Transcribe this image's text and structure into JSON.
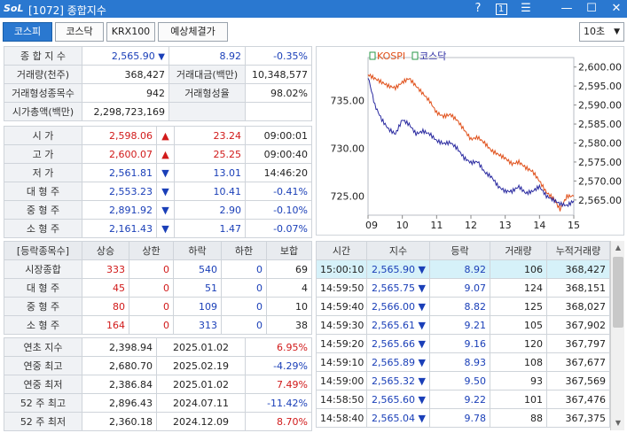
{
  "window": {
    "logo": "SoL",
    "title": "[1072] 종합지수",
    "help": "?",
    "one": "1",
    "menu": "☰",
    "minimize": "—",
    "maximize": "☐",
    "close": "✕"
  },
  "toolbar": {
    "tabs": [
      "코스피",
      "코스닥",
      "KRX100",
      "예상체결가"
    ],
    "active_tab": "코스피",
    "interval": "10초"
  },
  "summary": {
    "index_label": "종 합 지 수",
    "index_value": "2,565.90",
    "index_change": "8.92",
    "index_rate": "-0.35%",
    "volume_label": "거래량(천주)",
    "volume_value": "368,427",
    "amount_label": "거래대금(백만)",
    "amount_value": "10,348,577",
    "formed_count_label": "거래형성종목수",
    "formed_count_value": "942",
    "formed_rate_label": "거래형성율",
    "formed_rate_value": "98.02%",
    "mktcap_label": "시가총액(백만)",
    "mktcap_value": "2,298,723,169"
  },
  "prices": [
    {
      "label": "시      가",
      "value": "2,598.06",
      "dir": "up",
      "change": "23.24",
      "extra": "09:00:01"
    },
    {
      "label": "고      가",
      "value": "2,600.07",
      "dir": "up",
      "change": "25.25",
      "extra": "09:00:40"
    },
    {
      "label": "저      가",
      "value": "2,561.81",
      "dir": "dn",
      "change": "13.01",
      "extra": "14:46:20"
    },
    {
      "label": "대 형 주",
      "value": "2,553.23",
      "dir": "dn",
      "change": "10.41",
      "extra": "-0.41%"
    },
    {
      "label": "중 형 주",
      "value": "2,891.92",
      "dir": "dn",
      "change": "2.90",
      "extra": "-0.10%"
    },
    {
      "label": "소 형 주",
      "value": "2,161.43",
      "dir": "dn",
      "change": "1.47",
      "extra": "-0.07%"
    }
  ],
  "breadth": {
    "headers": [
      "[등락종목수]",
      "상승",
      "상한",
      "하락",
      "하한",
      "보합"
    ],
    "rows": [
      {
        "label": "시장종합",
        "rise": "333",
        "upper": "0",
        "fall": "540",
        "lower": "0",
        "flat": "69"
      },
      {
        "label": "대 형 주",
        "rise": "45",
        "upper": "0",
        "fall": "51",
        "lower": "0",
        "flat": "4"
      },
      {
        "label": "중 형 주",
        "rise": "80",
        "upper": "0",
        "fall": "109",
        "lower": "0",
        "flat": "10"
      },
      {
        "label": "소 형 주",
        "rise": "164",
        "upper": "0",
        "fall": "313",
        "lower": "0",
        "flat": "38"
      }
    ]
  },
  "yearly": [
    {
      "label": "연초  지수",
      "value": "2,398.94",
      "date": "2025.01.02",
      "rate": "6.95%",
      "dir": "up"
    },
    {
      "label": "연중  최고",
      "value": "2,680.70",
      "date": "2025.02.19",
      "rate": "-4.29%",
      "dir": "dn"
    },
    {
      "label": "연중  최저",
      "value": "2,386.84",
      "date": "2025.01.02",
      "rate": "7.49%",
      "dir": "up"
    },
    {
      "label": "52 주 최고",
      "value": "2,896.43",
      "date": "2024.07.11",
      "rate": "-11.42%",
      "dir": "dn"
    },
    {
      "label": "52 주 최저",
      "value": "2,360.18",
      "date": "2024.12.09",
      "rate": "8.70%",
      "dir": "up"
    }
  ],
  "ticks": {
    "headers": [
      "시간",
      "지수",
      "등락",
      "거래량",
      "누적거래량"
    ],
    "rows": [
      {
        "time": "15:00:10",
        "index": "2,565.90",
        "change": "8.92",
        "vol": "106",
        "cum": "368,427"
      },
      {
        "time": "14:59:50",
        "index": "2,565.75",
        "change": "9.07",
        "vol": "124",
        "cum": "368,151"
      },
      {
        "time": "14:59:40",
        "index": "2,566.00",
        "change": "8.82",
        "vol": "125",
        "cum": "368,027"
      },
      {
        "time": "14:59:30",
        "index": "2,565.61",
        "change": "9.21",
        "vol": "105",
        "cum": "367,902"
      },
      {
        "time": "14:59:20",
        "index": "2,565.66",
        "change": "9.16",
        "vol": "120",
        "cum": "367,797"
      },
      {
        "time": "14:59:10",
        "index": "2,565.89",
        "change": "8.93",
        "vol": "108",
        "cum": "367,677"
      },
      {
        "time": "14:59:00",
        "index": "2,565.32",
        "change": "9.50",
        "vol": "93",
        "cum": "367,569"
      },
      {
        "time": "14:58:50",
        "index": "2,565.60",
        "change": "9.22",
        "vol": "101",
        "cum": "367,476"
      },
      {
        "time": "14:58:40",
        "index": "2,565.04",
        "change": "9.78",
        "vol": "88",
        "cum": "367,375"
      }
    ],
    "selected_row": 0
  },
  "chart_data": {
    "type": "line",
    "x_ticks": [
      "09",
      "10",
      "11",
      "12",
      "13",
      "14",
      "15"
    ],
    "x_range": [
      9,
      15
    ],
    "left_axis": {
      "ticks": [
        "735.00",
        "730.00",
        "725.00"
      ],
      "range": [
        723.0,
        739.5
      ]
    },
    "right_axis": {
      "ticks": [
        "2,600.00",
        "2,595.00",
        "2,590.00",
        "2,585.00",
        "2,580.00",
        "2,575.00",
        "2,570.00",
        "2,565.00"
      ],
      "range": [
        2561.0,
        2602.5
      ]
    },
    "legend": "top-left",
    "series": [
      {
        "name": "KOSPI",
        "axis": "right",
        "color": "#e0501a",
        "x": [
          9.0,
          9.2,
          9.4,
          9.6,
          9.8,
          10.0,
          10.2,
          10.4,
          10.6,
          10.8,
          11.0,
          11.2,
          11.4,
          11.6,
          11.8,
          12.0,
          12.2,
          12.4,
          12.6,
          12.8,
          13.0,
          13.2,
          13.4,
          13.6,
          13.8,
          14.0,
          14.2,
          14.4,
          14.6,
          14.8,
          15.0
        ],
        "values": [
          2598.0,
          2597.0,
          2596.0,
          2595.0,
          2594.5,
          2596.0,
          2597.0,
          2595.0,
          2593.0,
          2591.0,
          2588.0,
          2587.0,
          2587.5,
          2586.0,
          2583.5,
          2581.0,
          2581.5,
          2580.0,
          2578.0,
          2577.0,
          2576.0,
          2574.5,
          2575.0,
          2573.5,
          2572.5,
          2570.0,
          2567.0,
          2565.5,
          2562.5,
          2566.0,
          2566.0
        ]
      },
      {
        "name": "코스닥",
        "axis": "left",
        "color": "#2a2aa0",
        "x": [
          9.0,
          9.2,
          9.4,
          9.6,
          9.8,
          10.0,
          10.2,
          10.4,
          10.6,
          10.8,
          11.0,
          11.2,
          11.4,
          11.6,
          11.8,
          12.0,
          12.2,
          12.4,
          12.6,
          12.8,
          13.0,
          13.2,
          13.4,
          13.6,
          13.8,
          14.0,
          14.2,
          14.4,
          14.6,
          14.8,
          15.0
        ],
        "values": [
          737.5,
          734.5,
          733.0,
          732.0,
          731.5,
          733.0,
          732.5,
          731.5,
          731.8,
          731.5,
          730.8,
          730.5,
          730.6,
          730.0,
          729.0,
          728.5,
          728.6,
          727.5,
          727.0,
          726.0,
          725.5,
          725.5,
          726.0,
          725.3,
          725.5,
          726.0,
          725.0,
          724.6,
          724.2,
          724.0,
          724.5
        ]
      }
    ]
  }
}
